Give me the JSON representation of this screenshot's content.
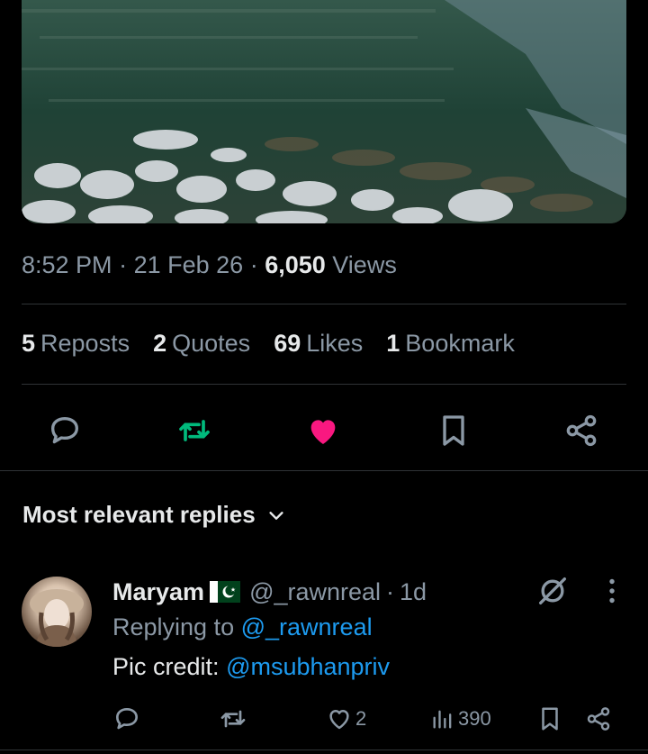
{
  "tweet": {
    "time": "8:52 PM",
    "date": "21 Feb 26",
    "views_count": "6,050",
    "views_label": "Views"
  },
  "stats": {
    "reposts": {
      "count": "5",
      "label": "Reposts"
    },
    "quotes": {
      "count": "2",
      "label": "Quotes"
    },
    "likes": {
      "count": "69",
      "label": "Likes"
    },
    "bookmarks": {
      "count": "1",
      "label": "Bookmark"
    }
  },
  "actions": {
    "reply_icon": "speech-bubble-icon",
    "repost_icon": "repost-arrows-icon",
    "like_icon": "heart-filled-icon",
    "bookmark_icon": "bookmark-icon",
    "share_icon": "share-nodes-icon",
    "colors": {
      "repost": "#00ba7c",
      "like": "#f91880",
      "muted": "#8b98a5",
      "link": "#1d9bf0"
    }
  },
  "replies_sort": {
    "label": "Most relevant replies"
  },
  "reply": {
    "name": "Maryam",
    "handle": "@_rawnreal",
    "separator": "·",
    "time": "1d",
    "replying_prefix": "Replying to",
    "replying_handle": "@_rawnreal",
    "text_prefix": "Pic credit:",
    "text_mention": "@msubhanpriv",
    "likes": "2",
    "views": "390"
  }
}
